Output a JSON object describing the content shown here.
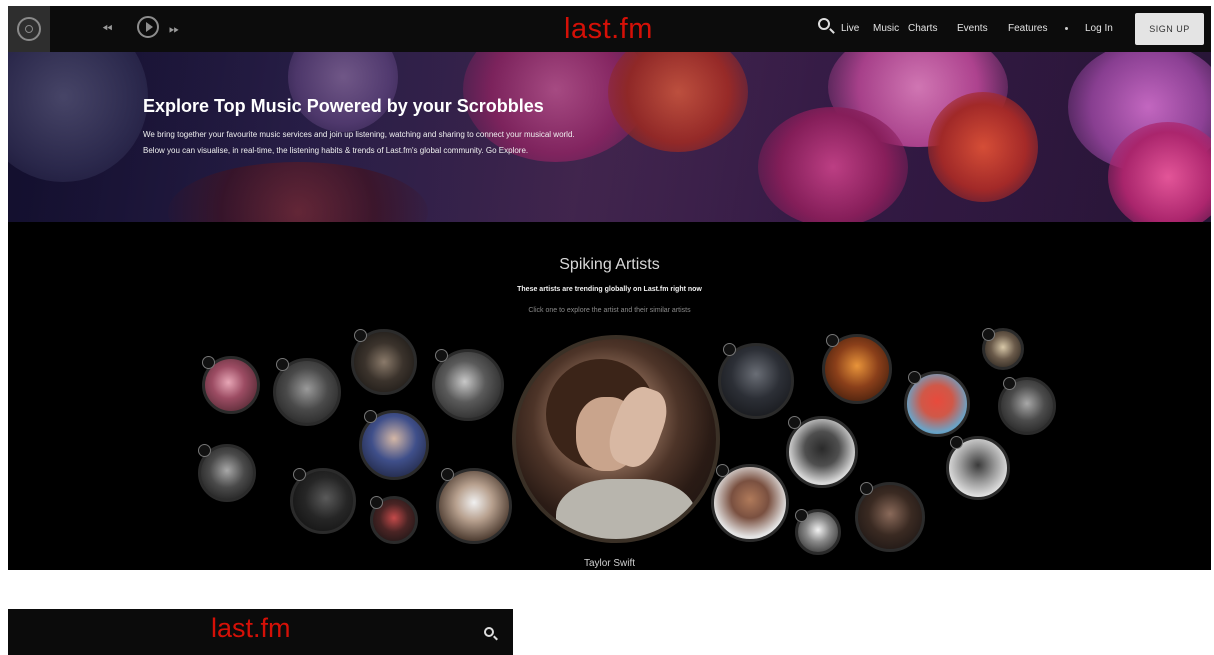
{
  "nav": {
    "rewind_icon": "rewind-icon",
    "play_icon": "play-icon",
    "forward_icon": "forward-icon",
    "logo": "last.fm",
    "links": [
      "Live",
      "Music",
      "Charts",
      "Events",
      "Features"
    ],
    "login": "Log In",
    "signup": "SIGN UP"
  },
  "hero": {
    "title": "Explore Top Music Powered by your Scrobbles",
    "line1": "We bring together your favourite music services and join up listening, watching and sharing to connect your musical world.",
    "line2": "Below you can visualise, in real-time, the listening habits & trends of Last.fm's global community. Go Explore."
  },
  "spiking": {
    "title": "Spiking Artists",
    "subtitle": "These artists are trending globally on Last.fm right now",
    "hint": "Click one to explore the artist and their similar artists",
    "featured_name": "Taylor Swift"
  },
  "mobile": {
    "logo": "last.fm"
  },
  "colors": {
    "brand_red": "#d51007",
    "background": "#000000"
  }
}
